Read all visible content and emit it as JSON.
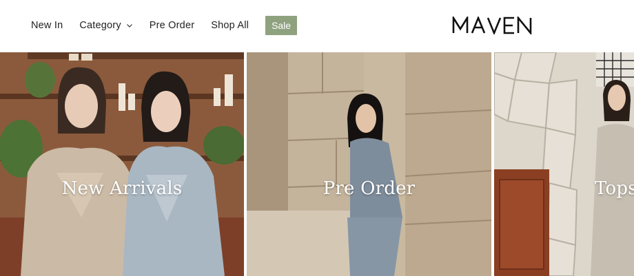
{
  "header": {
    "nav": [
      {
        "label": "New In"
      },
      {
        "label": "Category"
      },
      {
        "label": "Pre Order"
      },
      {
        "label": "Shop All"
      }
    ],
    "sale_label": "Sale",
    "logo_text": "MAVEN",
    "accent_color": "#8fa27f"
  },
  "gallery": {
    "tiles": [
      {
        "label": "New Arrivals"
      },
      {
        "label": "Pre Order"
      },
      {
        "label": "Tops"
      }
    ]
  }
}
